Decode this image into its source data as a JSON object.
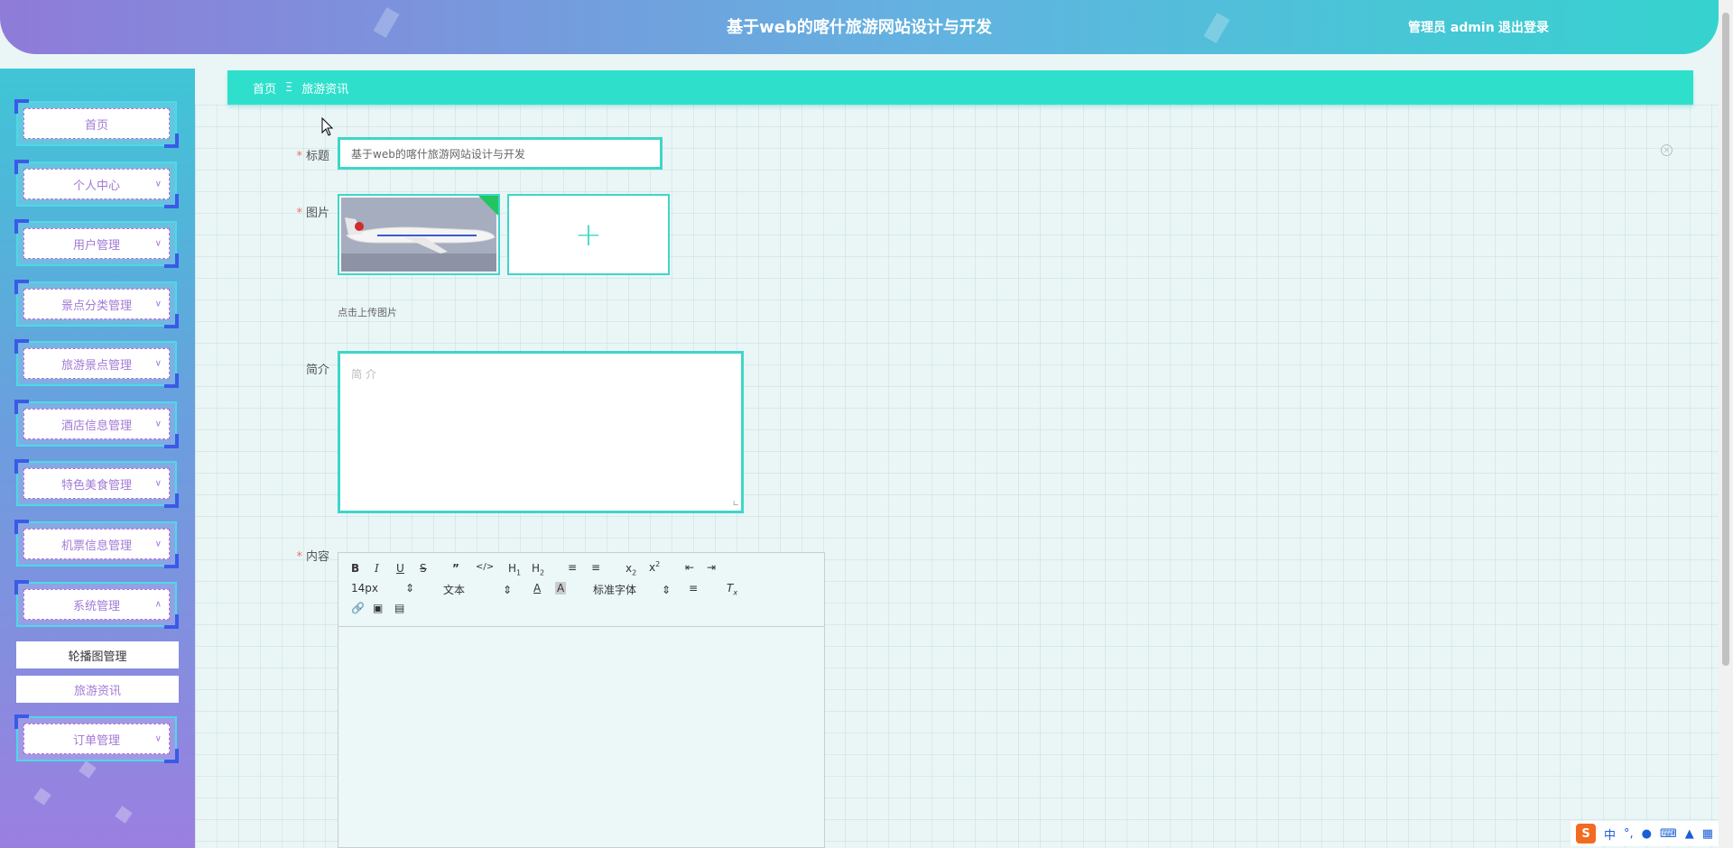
{
  "header": {
    "title": "基于web的喀什旅游网站设计与开发",
    "user_label": "管理员 admin",
    "logout_label": "退出登录"
  },
  "sidebar": {
    "items": [
      {
        "label": "首页",
        "has_arrow": false
      },
      {
        "label": "个人中心",
        "has_arrow": true
      },
      {
        "label": "用户管理",
        "has_arrow": true
      },
      {
        "label": "景点分类管理",
        "has_arrow": true
      },
      {
        "label": "旅游景点管理",
        "has_arrow": true
      },
      {
        "label": "酒店信息管理",
        "has_arrow": true
      },
      {
        "label": "特色美食管理",
        "has_arrow": true
      },
      {
        "label": "机票信息管理",
        "has_arrow": true
      },
      {
        "label": "系统管理",
        "has_arrow": true,
        "expanded": true
      },
      {
        "label": "订单管理",
        "has_arrow": true
      }
    ],
    "submenu": [
      {
        "label": "轮播图管理",
        "color": "#333333"
      },
      {
        "label": "旅游资讯",
        "color": "#a37ad6"
      }
    ]
  },
  "breadcrumb": {
    "home": "首页",
    "separator": "Ξ",
    "current": "旅游资讯"
  },
  "form": {
    "title_label": "标题",
    "title_value": "基于web的喀什旅游网站设计与开发",
    "image_label": "图片",
    "upload_hint": "点击上传图片",
    "intro_label": "简介",
    "intro_placeholder": "简介",
    "content_label": "内容"
  },
  "editor": {
    "font_size": "14px",
    "text_style": "文本",
    "font_family": "标准字体"
  },
  "colors": {
    "accent": "#2ee0cc",
    "border": "#3ed6c9",
    "menu_text": "#a37ad6"
  }
}
